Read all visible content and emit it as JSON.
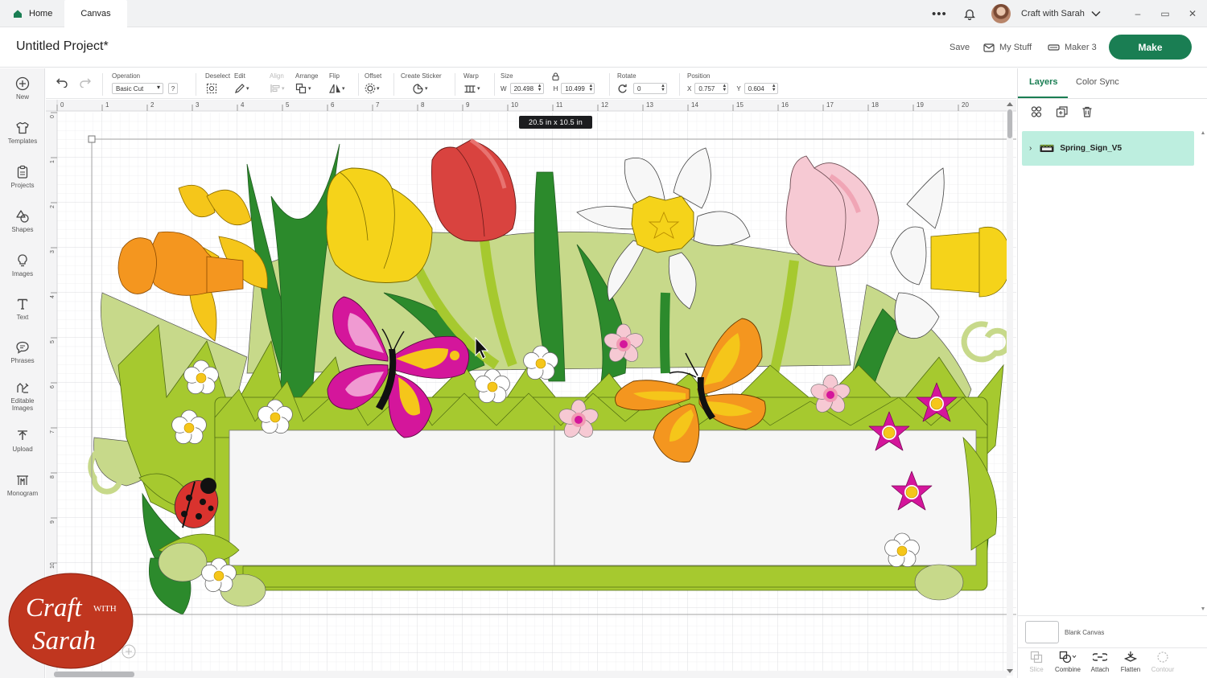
{
  "titlebar": {
    "tabs": [
      {
        "label": "Home"
      },
      {
        "label": "Canvas"
      }
    ],
    "more_label": "•••",
    "account_name": "Craft with Sarah",
    "window_controls": [
      "–",
      "▭",
      "✕"
    ]
  },
  "header": {
    "project_title": "Untitled Project*",
    "save_label": "Save",
    "my_stuff_label": "My Stuff",
    "machine_label": "Maker 3",
    "make_label": "Make"
  },
  "sidebar": {
    "items": [
      {
        "label": "New",
        "icon": "plus-circle-icon"
      },
      {
        "label": "Templates",
        "icon": "shirt-icon"
      },
      {
        "label": "Projects",
        "icon": "clipboard-icon"
      },
      {
        "label": "Shapes",
        "icon": "shapes-icon"
      },
      {
        "label": "Images",
        "icon": "lightbulb-icon"
      },
      {
        "label": "Text",
        "icon": "text-icon"
      },
      {
        "label": "Phrases",
        "icon": "speech-bubble-icon"
      },
      {
        "label": "Editable Images",
        "icon": "editable-image-icon"
      },
      {
        "label": "Upload",
        "icon": "upload-icon"
      },
      {
        "label": "Monogram",
        "icon": "monogram-icon"
      }
    ]
  },
  "toolbar": {
    "operation_label": "Operation",
    "operation_value": "Basic Cut",
    "help_label": "?",
    "deselect_label": "Deselect",
    "edit_label": "Edit",
    "align_label": "Align",
    "arrange_label": "Arrange",
    "flip_label": "Flip",
    "offset_label": "Offset",
    "create_sticker_label": "Create Sticker",
    "warp_label": "Warp",
    "size_label": "Size",
    "size_w_prefix": "W",
    "size_w": "20.498",
    "size_h_prefix": "H",
    "size_h": "10.499",
    "rotate_label": "Rotate",
    "rotate_value": "0",
    "position_label": "Position",
    "pos_x_prefix": "X",
    "pos_x": "0.757",
    "pos_y_prefix": "Y",
    "pos_y": "0.604"
  },
  "canvas": {
    "size_tooltip": "20.5  in x 10.5  in",
    "ruler_top": [
      "0",
      "1",
      "2",
      "3",
      "4",
      "5",
      "6",
      "7",
      "8",
      "9",
      "10",
      "11",
      "12",
      "13",
      "14",
      "15",
      "16",
      "17",
      "18",
      "19",
      "20"
    ],
    "ruler_left": [
      "0",
      "1",
      "2",
      "3",
      "4",
      "5",
      "6",
      "7",
      "8",
      "9",
      "10"
    ],
    "colors": {
      "grid": "#e6e7e9",
      "leaf_light": "#a6c92f",
      "leaf_pale": "#c7d98a",
      "leaf_dark": "#2c8a2c",
      "daffodil": "#f5c61a",
      "daffodil_trumpet": "#f4961f",
      "tulip_red": "#d9433f",
      "tulip_pink": "#f4c2cb",
      "butterfly_magenta": "#d4169b",
      "butterfly_orange": "#f4961f",
      "flower_magenta": "#d4169b",
      "sign_panel": "#f6f6f6"
    }
  },
  "brand_logo": {
    "line1": "Craft",
    "with": "WITH",
    "line2": "Sarah",
    "color": "#c0361f"
  },
  "right_panel": {
    "tabs": [
      {
        "label": "Layers"
      },
      {
        "label": "Color Sync"
      }
    ],
    "layer_name": "Spring_Sign_V5",
    "blank_canvas_label": "Blank Canvas",
    "actions": [
      {
        "label": "Slice",
        "enabled": false,
        "icon": "slice-icon"
      },
      {
        "label": "Combine",
        "enabled": true,
        "icon": "combine-icon"
      },
      {
        "label": "Attach",
        "enabled": true,
        "icon": "attach-icon"
      },
      {
        "label": "Flatten",
        "enabled": true,
        "icon": "flatten-icon"
      },
      {
        "label": "Contour",
        "enabled": false,
        "icon": "contour-icon"
      }
    ],
    "accent": "#1a7e53",
    "selected_row_color": "#bdeedf"
  }
}
